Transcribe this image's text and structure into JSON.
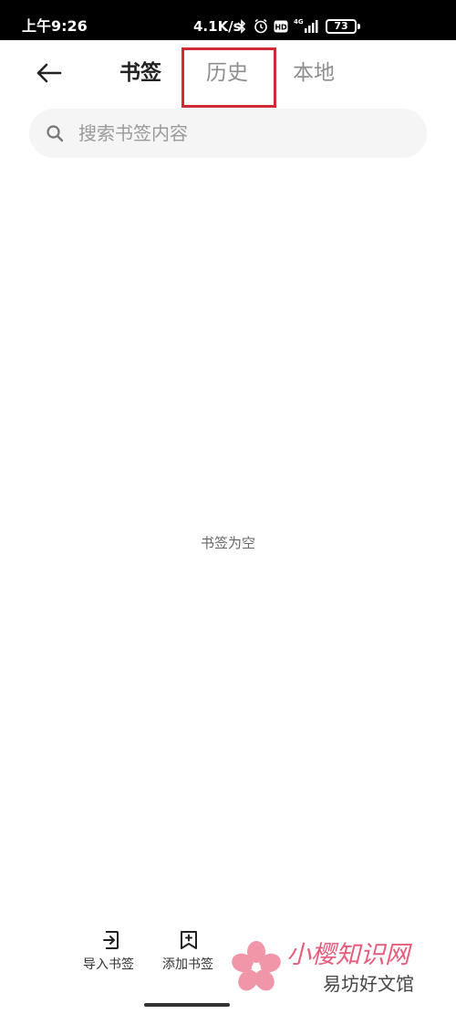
{
  "status_bar": {
    "time": "上午9:26",
    "network_speed": "4.1K/s",
    "battery_level": "73",
    "battery_percent": 73,
    "icons": [
      "bluetooth-icon",
      "alarm-icon",
      "hd-icon",
      "4g-signal-icon",
      "battery-icon"
    ]
  },
  "nav": {
    "back_icon": "back-arrow-icon",
    "tabs": [
      {
        "label": "书签",
        "active": true
      },
      {
        "label": "历史",
        "active": false,
        "highlighted": true
      },
      {
        "label": "本地",
        "active": false
      }
    ],
    "highlight_color": "#d02b35"
  },
  "search": {
    "placeholder": "搜索书签内容",
    "icon": "search-icon"
  },
  "empty_state": {
    "message": "书签为空"
  },
  "bottom_actions": [
    {
      "label": "导入书签",
      "icon": "import-icon"
    },
    {
      "label": "添加书签",
      "icon": "add-bookmark-icon"
    }
  ],
  "watermark": {
    "brand": "小樱知识网",
    "site": "易坊好文馆",
    "color": "#e85a7a"
  }
}
